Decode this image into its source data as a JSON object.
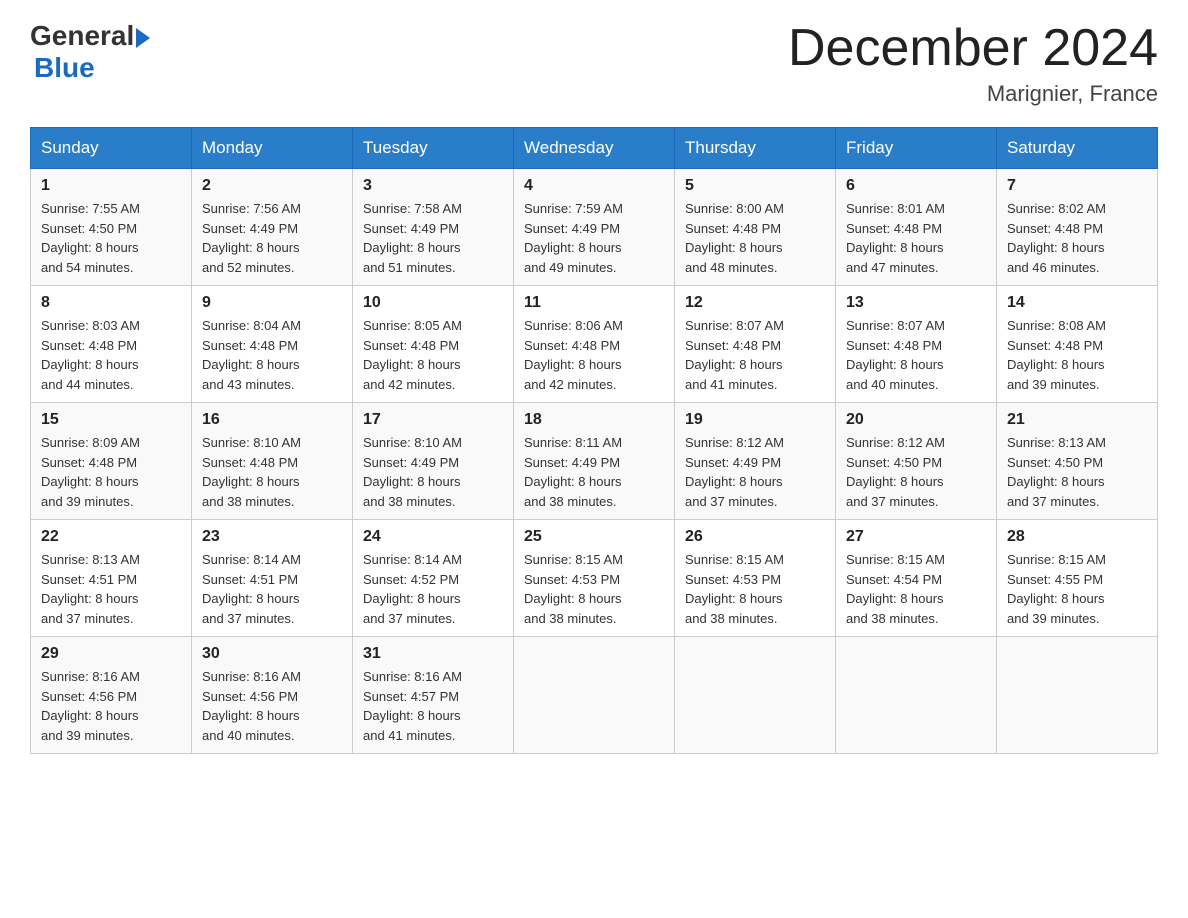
{
  "header": {
    "logo_general": "General",
    "logo_blue": "Blue",
    "month_title": "December 2024",
    "location": "Marignier, France"
  },
  "days_of_week": [
    "Sunday",
    "Monday",
    "Tuesday",
    "Wednesday",
    "Thursday",
    "Friday",
    "Saturday"
  ],
  "weeks": [
    [
      {
        "day": "1",
        "sunrise": "7:55 AM",
        "sunset": "4:50 PM",
        "daylight": "8 hours and 54 minutes."
      },
      {
        "day": "2",
        "sunrise": "7:56 AM",
        "sunset": "4:49 PM",
        "daylight": "8 hours and 52 minutes."
      },
      {
        "day": "3",
        "sunrise": "7:58 AM",
        "sunset": "4:49 PM",
        "daylight": "8 hours and 51 minutes."
      },
      {
        "day": "4",
        "sunrise": "7:59 AM",
        "sunset": "4:49 PM",
        "daylight": "8 hours and 49 minutes."
      },
      {
        "day": "5",
        "sunrise": "8:00 AM",
        "sunset": "4:48 PM",
        "daylight": "8 hours and 48 minutes."
      },
      {
        "day": "6",
        "sunrise": "8:01 AM",
        "sunset": "4:48 PM",
        "daylight": "8 hours and 47 minutes."
      },
      {
        "day": "7",
        "sunrise": "8:02 AM",
        "sunset": "4:48 PM",
        "daylight": "8 hours and 46 minutes."
      }
    ],
    [
      {
        "day": "8",
        "sunrise": "8:03 AM",
        "sunset": "4:48 PM",
        "daylight": "8 hours and 44 minutes."
      },
      {
        "day": "9",
        "sunrise": "8:04 AM",
        "sunset": "4:48 PM",
        "daylight": "8 hours and 43 minutes."
      },
      {
        "day": "10",
        "sunrise": "8:05 AM",
        "sunset": "4:48 PM",
        "daylight": "8 hours and 42 minutes."
      },
      {
        "day": "11",
        "sunrise": "8:06 AM",
        "sunset": "4:48 PM",
        "daylight": "8 hours and 42 minutes."
      },
      {
        "day": "12",
        "sunrise": "8:07 AM",
        "sunset": "4:48 PM",
        "daylight": "8 hours and 41 minutes."
      },
      {
        "day": "13",
        "sunrise": "8:07 AM",
        "sunset": "4:48 PM",
        "daylight": "8 hours and 40 minutes."
      },
      {
        "day": "14",
        "sunrise": "8:08 AM",
        "sunset": "4:48 PM",
        "daylight": "8 hours and 39 minutes."
      }
    ],
    [
      {
        "day": "15",
        "sunrise": "8:09 AM",
        "sunset": "4:48 PM",
        "daylight": "8 hours and 39 minutes."
      },
      {
        "day": "16",
        "sunrise": "8:10 AM",
        "sunset": "4:48 PM",
        "daylight": "8 hours and 38 minutes."
      },
      {
        "day": "17",
        "sunrise": "8:10 AM",
        "sunset": "4:49 PM",
        "daylight": "8 hours and 38 minutes."
      },
      {
        "day": "18",
        "sunrise": "8:11 AM",
        "sunset": "4:49 PM",
        "daylight": "8 hours and 38 minutes."
      },
      {
        "day": "19",
        "sunrise": "8:12 AM",
        "sunset": "4:49 PM",
        "daylight": "8 hours and 37 minutes."
      },
      {
        "day": "20",
        "sunrise": "8:12 AM",
        "sunset": "4:50 PM",
        "daylight": "8 hours and 37 minutes."
      },
      {
        "day": "21",
        "sunrise": "8:13 AM",
        "sunset": "4:50 PM",
        "daylight": "8 hours and 37 minutes."
      }
    ],
    [
      {
        "day": "22",
        "sunrise": "8:13 AM",
        "sunset": "4:51 PM",
        "daylight": "8 hours and 37 minutes."
      },
      {
        "day": "23",
        "sunrise": "8:14 AM",
        "sunset": "4:51 PM",
        "daylight": "8 hours and 37 minutes."
      },
      {
        "day": "24",
        "sunrise": "8:14 AM",
        "sunset": "4:52 PM",
        "daylight": "8 hours and 37 minutes."
      },
      {
        "day": "25",
        "sunrise": "8:15 AM",
        "sunset": "4:53 PM",
        "daylight": "8 hours and 38 minutes."
      },
      {
        "day": "26",
        "sunrise": "8:15 AM",
        "sunset": "4:53 PM",
        "daylight": "8 hours and 38 minutes."
      },
      {
        "day": "27",
        "sunrise": "8:15 AM",
        "sunset": "4:54 PM",
        "daylight": "8 hours and 38 minutes."
      },
      {
        "day": "28",
        "sunrise": "8:15 AM",
        "sunset": "4:55 PM",
        "daylight": "8 hours and 39 minutes."
      }
    ],
    [
      {
        "day": "29",
        "sunrise": "8:16 AM",
        "sunset": "4:56 PM",
        "daylight": "8 hours and 39 minutes."
      },
      {
        "day": "30",
        "sunrise": "8:16 AM",
        "sunset": "4:56 PM",
        "daylight": "8 hours and 40 minutes."
      },
      {
        "day": "31",
        "sunrise": "8:16 AM",
        "sunset": "4:57 PM",
        "daylight": "8 hours and 41 minutes."
      },
      null,
      null,
      null,
      null
    ]
  ],
  "labels": {
    "sunrise": "Sunrise:",
    "sunset": "Sunset:",
    "daylight": "Daylight:"
  }
}
